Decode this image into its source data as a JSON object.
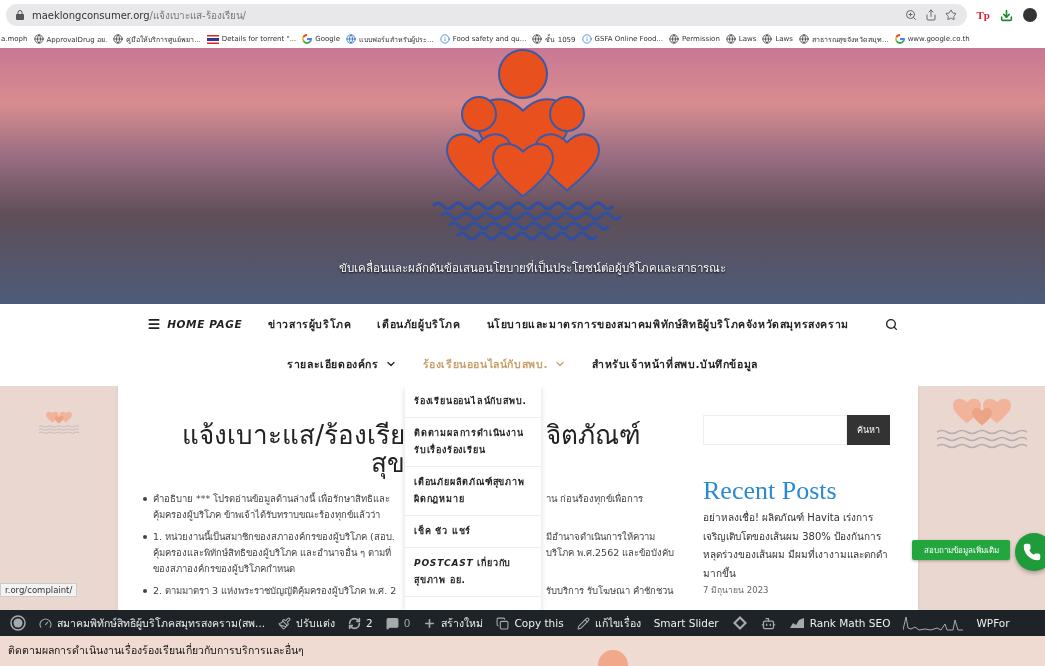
{
  "browser": {
    "url": {
      "host": "maeklongconsumer.org",
      "path": "/แจ้งเบาะแส-ร้องเรียน/"
    },
    "extensions": [
      {
        "kind": "text",
        "label": "Tp"
      },
      {
        "kind": "download"
      },
      {
        "kind": "avatar"
      }
    ],
    "bookmarks": [
      {
        "kind": "none",
        "label": "a.moph"
      },
      {
        "kind": "globe",
        "label": "ApprovalDrug อย."
      },
      {
        "kind": "globe",
        "label": "คู่มือให้บริการศูนย์พยา..."
      },
      {
        "kind": "flag",
        "label": "Details for torrent \"..."
      },
      {
        "kind": "google",
        "label": "Google"
      },
      {
        "kind": "globe-blue",
        "label": "แบบฟอร์มสำหรับผู้ประ..."
      },
      {
        "kind": "info",
        "label": "Food safety and qu..."
      },
      {
        "kind": "globe",
        "label": "ชั้น 1059"
      },
      {
        "kind": "info",
        "label": "GSFA Online Food..."
      },
      {
        "kind": "globe",
        "label": "Permission"
      },
      {
        "kind": "globe",
        "label": "Laws"
      },
      {
        "kind": "globe",
        "label": "Laws"
      },
      {
        "kind": "globe",
        "label": "สาธารณสุขจังหวัดสมุท..."
      },
      {
        "kind": "google",
        "label": "www.google.co.th"
      }
    ]
  },
  "hero": {
    "tagline": "ขับเคลื่อนและผลักดันข้อเสนอนโยบายที่เป็นประโยชน์ต่อผู้บริโภคและสาธารณะ"
  },
  "nav": {
    "primary": [
      {
        "kind": "home",
        "label": "HOME PAGE",
        "selected": false
      },
      {
        "kind": "link",
        "label": "ข่าวสารผู้บริโภค",
        "selected": false
      },
      {
        "kind": "link",
        "label": "เตือนภัยผู้บริโภค",
        "selected": false
      },
      {
        "kind": "link",
        "label": "นโยบายและมาตรการของสมาคมพิทักษ์สิทธิผู้บริโภคจังหวัดสมุทรสงคราม",
        "selected": false
      }
    ],
    "secondary": [
      {
        "label": "รายละเอียดองค์กร",
        "has_submenu": true,
        "selected": false
      },
      {
        "label": "ร้องเรียนออนไลน์กับสพบ.",
        "has_submenu": true,
        "selected": true
      },
      {
        "label": "สำหรับเจ้าหน้าที่สพบ.บันทึกข้อมูล",
        "has_submenu": false,
        "selected": false
      }
    ]
  },
  "submenu": [
    "ร้องเรียนออนไลน์กับสพบ.",
    "ติดตามผลการดำเนินงานรับเรื่องร้องเรียน",
    "เตือนภัยผลิตภัณฑ์สุขภาพผิดกฎหมาย",
    "เช็ค ชัว แชร์",
    "*POSTCAST* เกี่ยวกับสุขภาพ อย."
  ],
  "article": {
    "title_lines": [
      {
        "left": "แจ้งเบาะแส/ร้องเรีย",
        "right": "จิตภัณฑ์"
      },
      {
        "left": "สุข"
      }
    ],
    "lines": [
      {
        "bullet": true,
        "left": "คำอธิบาย *** โปรดอ่านข้อมูลด้านล่างนี้ เพื่อรักษาสิทธิและ",
        "right": "าน ก่อนร้องทุกข์เพื่อการ"
      },
      {
        "bullet": false,
        "left": "คุ้มครองผู้บริโภค ข้าพเจ้าได้รับทราบขณะร้องทุกข์แล้วว่า"
      },
      {
        "bullet": true,
        "left": "1. หน่วยงานนี้เป็นสมาชิกของสภาองค์กรของผู้บริโภค (สอบ.",
        "right": "มีอำนาจดำเนินการให้ความ"
      },
      {
        "bullet": false,
        "left": "คุ้มครองและพิทักษ์สิทธิของผู้บริโภค และอำนาจอื่น ๆ ตามที่",
        "right": "บริโภค พ.ศ.2562 และข้อบังคับ"
      },
      {
        "bullet": false,
        "left": "ของสภาองค์กรของผู้บริโภคกำหนด"
      },
      {
        "bullet": true,
        "left": "2. ตามมาตรา 3 แห่งพระราชบัญญัติคุ้มครองผู้บริโภค พ.ศ. 2",
        "right": "รับบริการ รับโฆษณา คำชักชวน"
      }
    ]
  },
  "sidebar": {
    "search_button": "ค้นหา",
    "heading": "Recent Posts",
    "post": "อย่าหลงเชื่อ! ผลิตภัณฑ์ Havita เร่งการเจริญเติบโตของเส้นผม 380% ป้องกันการหลุดร่วงของเส้นผม มีผมที่เงางามและดกดำมากขึ้น",
    "date": "7 มิถุนายน 2023"
  },
  "contact_button": "สอบถามข้อมูลเพิ่มเติม",
  "status_url": "r.org/complaint/",
  "admin_bar": [
    {
      "kind": "wordpress"
    },
    {
      "kind": "dashboard",
      "label": "สมาคมพิทักษ์สิทธิผู้บริโภคสมุทรสงคราม(สพ..."
    },
    {
      "kind": "brush",
      "label": "ปรับแต่ง"
    },
    {
      "kind": "updates",
      "label": "2"
    },
    {
      "kind": "comments",
      "label": "0"
    },
    {
      "kind": "new",
      "label": "สร้างใหม่"
    },
    {
      "kind": "copy",
      "label": "Copy this"
    },
    {
      "kind": "edit",
      "label": "แก้ไขเรื่อง"
    },
    {
      "kind": "text",
      "label": "Smart Slider"
    },
    {
      "kind": "diamond"
    },
    {
      "kind": "robot"
    },
    {
      "kind": "seo",
      "label": "Rank Math SEO"
    },
    {
      "kind": "sparkline"
    },
    {
      "kind": "text",
      "label": "WPFor"
    }
  ],
  "notice": "ติดตามผลการดำเนินงานเรื่องร้องเรียนเกี่ยวกับการบริการและอื่นๆ"
}
